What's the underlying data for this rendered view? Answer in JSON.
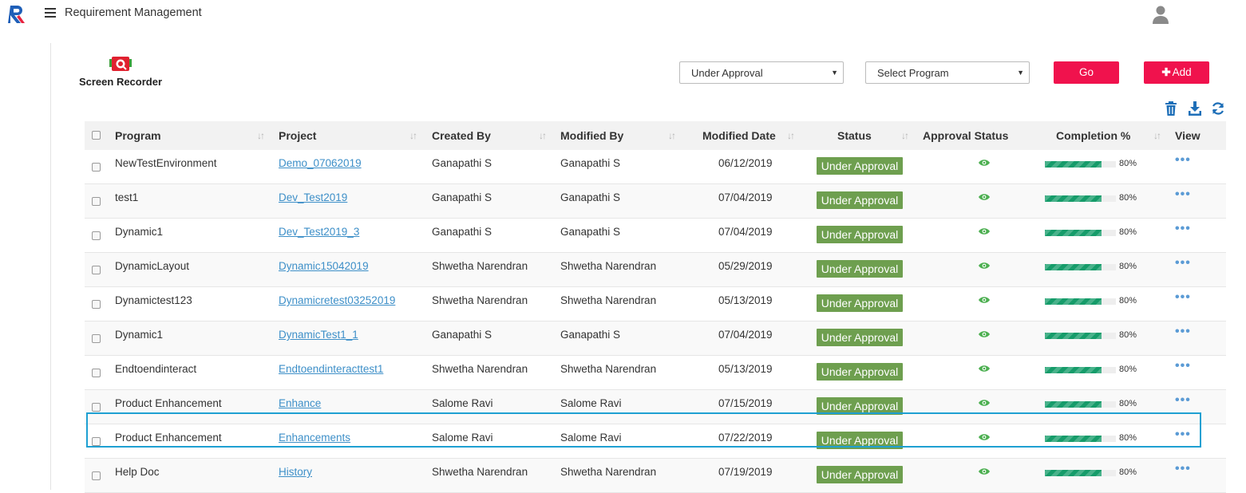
{
  "header": {
    "app_title": "Requirement Management",
    "logo_icon": "rk-logo-icon",
    "user_icon": "user-avatar-icon"
  },
  "recorder": {
    "label": "Screen Recorder",
    "icon": "screen-recorder-icon"
  },
  "toolbar": {
    "status_select": "Under Approval",
    "program_select": "Select Program",
    "go_label": "Go",
    "add_label": "Add",
    "icons": [
      "trash-icon",
      "download-icon",
      "refresh-icon"
    ],
    "accent_color": "#f0124d"
  },
  "table": {
    "columns": [
      "Program",
      "Project",
      "Created By",
      "Modified By",
      "Modified Date",
      "Status",
      "Approval Status",
      "Completion %",
      "View"
    ],
    "status_color": "#6e9f4f",
    "progress_color": "#169c6a",
    "rows": [
      {
        "program": "NewTestEnvironment",
        "project": "Demo_07062019",
        "created_by": "Ganapathi S",
        "modified_by": "Ganapathi S",
        "modified_date": "06/12/2019",
        "status": "Under Approval",
        "completion": "80%",
        "completion_value": 80
      },
      {
        "program": "test1",
        "project": "Dev_Test2019",
        "created_by": "Ganapathi S",
        "modified_by": "Ganapathi S",
        "modified_date": "07/04/2019",
        "status": "Under Approval",
        "completion": "80%",
        "completion_value": 80
      },
      {
        "program": "Dynamic1",
        "project": "Dev_Test2019_3",
        "created_by": "Ganapathi S",
        "modified_by": "Ganapathi S",
        "modified_date": "07/04/2019",
        "status": "Under Approval",
        "completion": "80%",
        "completion_value": 80
      },
      {
        "program": "DynamicLayout",
        "project": "Dynamic15042019",
        "created_by": "Shwetha Narendran",
        "modified_by": "Shwetha Narendran",
        "modified_date": "05/29/2019",
        "status": "Under Approval",
        "completion": "80%",
        "completion_value": 80
      },
      {
        "program": "Dynamictest123",
        "project": "Dynamicretest03252019",
        "created_by": "Shwetha Narendran",
        "modified_by": "Shwetha Narendran",
        "modified_date": "05/13/2019",
        "status": "Under Approval",
        "completion": "80%",
        "completion_value": 80
      },
      {
        "program": "Dynamic1",
        "project": "DynamicTest1_1",
        "created_by": "Ganapathi S",
        "modified_by": "Ganapathi S",
        "modified_date": "07/04/2019",
        "status": "Under Approval",
        "completion": "80%",
        "completion_value": 80
      },
      {
        "program": "Endtoendinteract",
        "project": "Endtoendinteracttest1",
        "created_by": "Shwetha Narendran",
        "modified_by": "Shwetha Narendran",
        "modified_date": "05/13/2019",
        "status": "Under Approval",
        "completion": "80%",
        "completion_value": 80
      },
      {
        "program": "Product Enhancement",
        "project": "Enhance",
        "created_by": "Salome Ravi",
        "modified_by": "Salome Ravi",
        "modified_date": "07/15/2019",
        "status": "Under Approval",
        "completion": "80%",
        "completion_value": 80
      },
      {
        "program": "Product Enhancement",
        "project": "Enhancements",
        "created_by": "Salome Ravi",
        "modified_by": "Salome Ravi",
        "modified_date": "07/22/2019",
        "status": "Under Approval",
        "completion": "80%",
        "completion_value": 80,
        "highlighted": true
      },
      {
        "program": "Help Doc",
        "project": "History",
        "created_by": "Shwetha Narendran",
        "modified_by": "Shwetha Narendran",
        "modified_date": "07/19/2019",
        "status": "Under Approval",
        "completion": "80%",
        "completion_value": 80
      }
    ]
  }
}
